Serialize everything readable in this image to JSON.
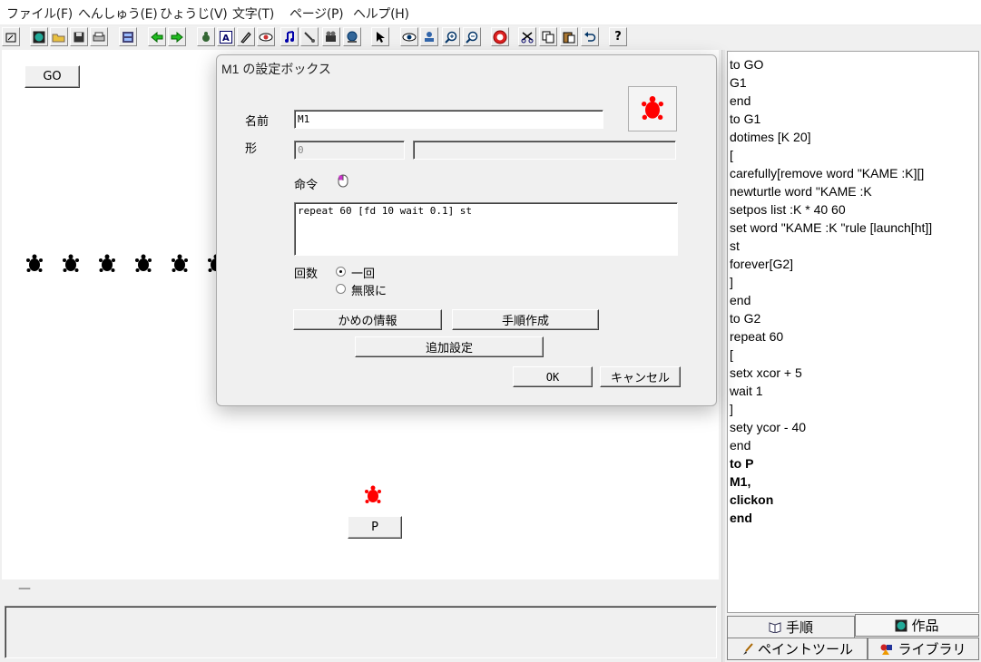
{
  "menu": [
    "ファイル(F)",
    "へんしゅう(E)",
    "ひょうじ(V)",
    "文字(T)",
    "ページ(P)",
    "ヘルプ(H)"
  ],
  "toolbar": {
    "icons": [
      "window-icon",
      "globe-icon",
      "open-folder-icon",
      "save-icon",
      "print-icon",
      "book-icon",
      "back-arrow-icon",
      "forward-arrow-icon",
      "turtle-icon",
      "text-box-icon",
      "paint-icon",
      "eye-hide-icon",
      "music-note-icon",
      "brush-icon",
      "camera-icon",
      "web-icon",
      "pointer-icon",
      "eye-icon",
      "stamp-icon",
      "zoom-in-icon",
      "zoom-out-icon",
      "stop-icon",
      "cut-icon",
      "copy-icon",
      "paste-icon",
      "undo-icon",
      "help-icon"
    ],
    "help_glyph": "?"
  },
  "canvas": {
    "go_button": "GO",
    "p_button": "P",
    "black_turtle_count": 6,
    "turtle_black": "#000000",
    "turtle_red": "#ff0000",
    "bottom_mark": "—"
  },
  "dialog": {
    "title": "M1 の設定ボックス",
    "name_label": "名前",
    "name_value": "M1",
    "shape_label": "形",
    "shape_value": "0",
    "command_label": "命令",
    "command_text": "repeat 60 [fd 10 wait 0.1] st",
    "count_label": "回数",
    "radio_once": "一回",
    "radio_infinite": "無限に",
    "turtle_info_button": "かめの情報",
    "procedure_button": "手順作成",
    "add_settings_button": "追加設定",
    "ok_button": "OK",
    "cancel_button": "キャンセル"
  },
  "code_lines": [
    {
      "text": "to GO",
      "bold": false
    },
    {
      "text": "G1",
      "bold": false
    },
    {
      "text": "end",
      "bold": false
    },
    {
      "text": "to G1",
      "bold": false
    },
    {
      "text": "dotimes [K 20]",
      "bold": false
    },
    {
      "text": "[",
      "bold": false
    },
    {
      "text": "carefully[remove word \"KAME :K][]",
      "bold": false
    },
    {
      "text": "newturtle word \"KAME :K",
      "bold": false
    },
    {
      "text": "setpos list :K * 40 60",
      "bold": false
    },
    {
      "text": "set word \"KAME :K \"rule [launch[ht]]",
      "bold": false
    },
    {
      "text": "st",
      "bold": false
    },
    {
      "text": "forever[G2]",
      "bold": false
    },
    {
      "text": "]",
      "bold": false
    },
    {
      "text": "end",
      "bold": false
    },
    {
      "text": "to G2",
      "bold": false
    },
    {
      "text": "repeat 60",
      "bold": false
    },
    {
      "text": "[",
      "bold": false
    },
    {
      "text": "setx xcor + 5",
      "bold": false
    },
    {
      "text": "wait 1",
      "bold": false
    },
    {
      "text": "]",
      "bold": false
    },
    {
      "text": "sety ycor - 40",
      "bold": false
    },
    {
      "text": "end",
      "bold": false
    },
    {
      "text": "to P",
      "bold": true
    },
    {
      "text": "M1,",
      "bold": true
    },
    {
      "text": "clickon",
      "bold": true
    },
    {
      "text": "end",
      "bold": true
    }
  ],
  "panel_tabs": {
    "procedures": "手順",
    "works": "作品",
    "paint_tool": "ペイントツール",
    "library": "ライブラリ"
  }
}
